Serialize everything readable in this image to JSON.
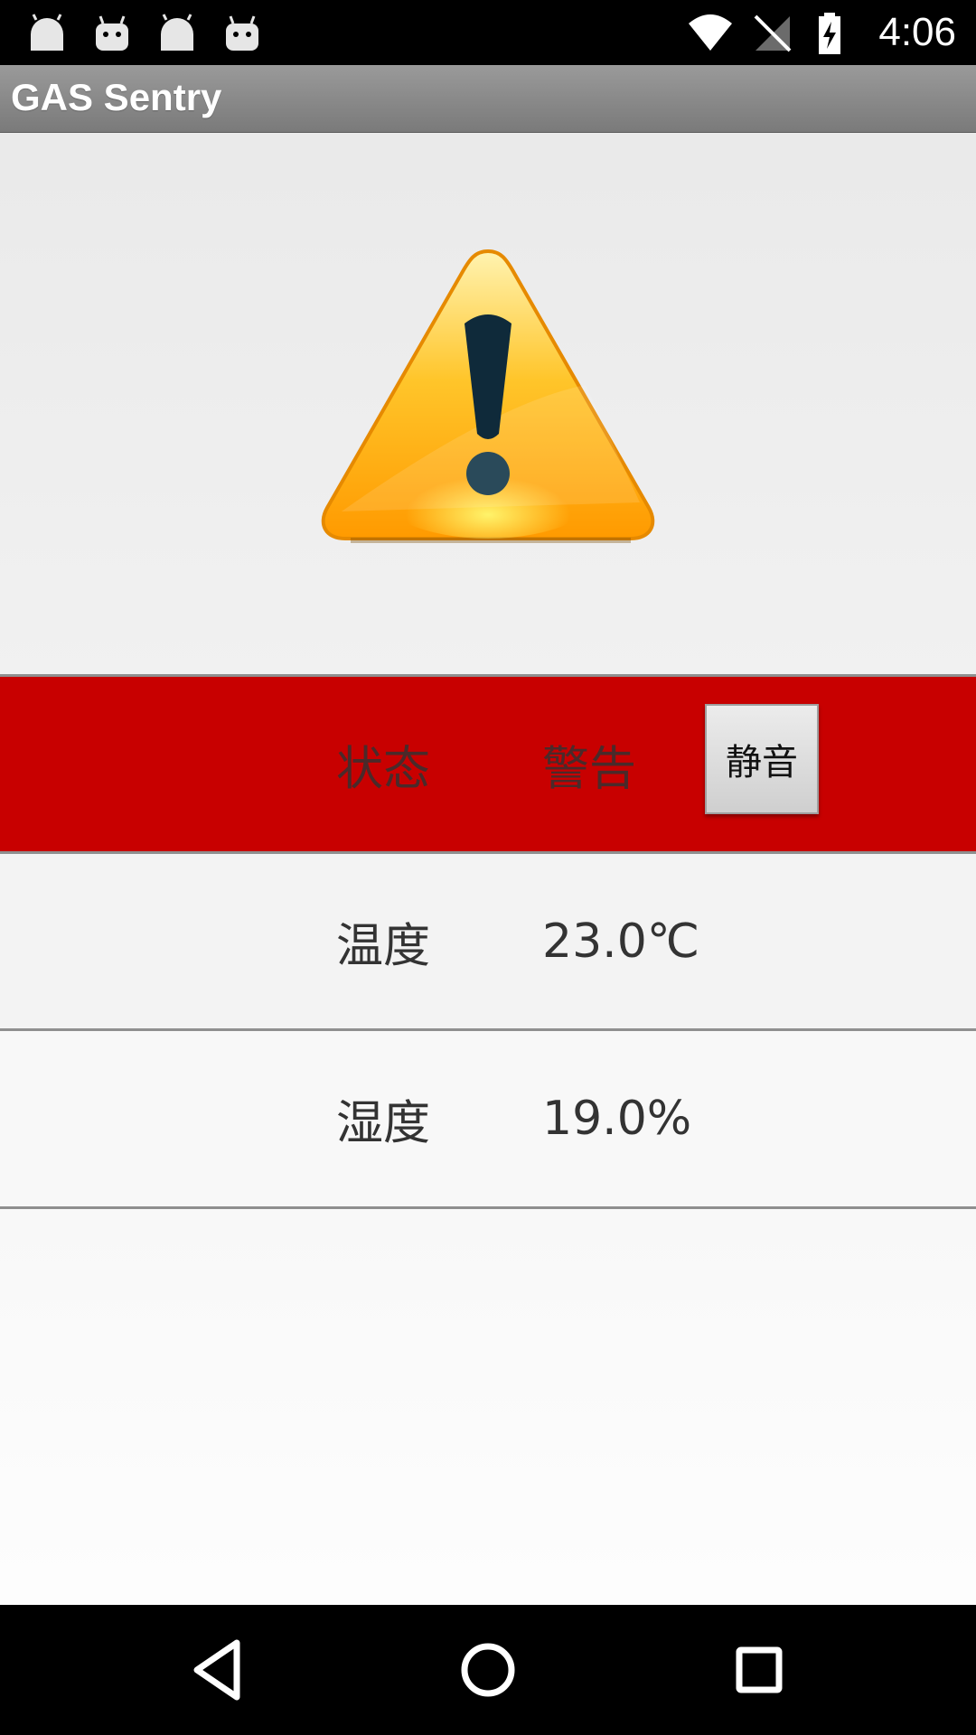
{
  "status_bar": {
    "time": "4:06",
    "notification_icons": [
      "android-icon",
      "android-icon",
      "android-icon",
      "android-icon"
    ],
    "system_icons": [
      "wifi-icon",
      "no-sim-icon",
      "battery-charging-icon"
    ]
  },
  "app": {
    "title": "GAS Sentry"
  },
  "warning": {
    "icon": "warning-triangle-icon"
  },
  "rows": {
    "status": {
      "label": "状态",
      "value": "警告",
      "mute_button": "静音",
      "background": "#c80000"
    },
    "temperature": {
      "label": "温度",
      "value": "23.0℃"
    },
    "humidity": {
      "label": "湿度",
      "value": "19.0%"
    }
  },
  "nav_bar": {
    "buttons": [
      "back-icon",
      "home-icon",
      "recent-apps-icon"
    ]
  }
}
